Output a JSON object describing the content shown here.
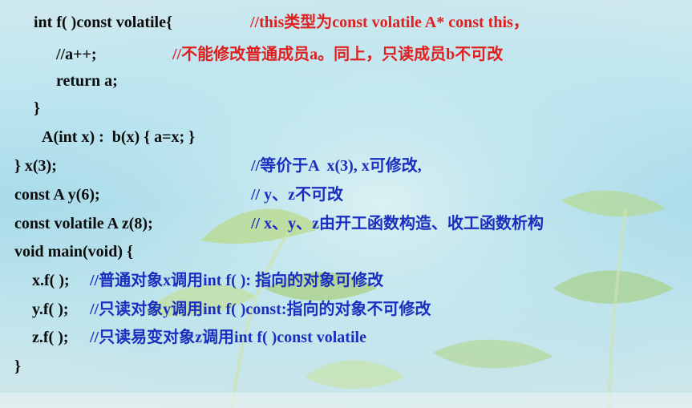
{
  "code_lines": [
    {
      "code": "int f( )const volatile{",
      "comment": "//this类型为const volatile A* const this，"
    },
    {
      "code": "//a++;",
      "comment": "//不能修改普通成员a。同上，只读成员b不可改"
    },
    {
      "code": "return a;"
    },
    {
      "code": "}"
    },
    {
      "code": "A(int x) :  b(x) { a=x; }"
    },
    {
      "code": "} x(3);",
      "comment": "//等价于A  x(3), x可修改,"
    },
    {
      "code": "const A y(6);",
      "comment": "// y、z不可改"
    },
    {
      "code": "const volatile A z(8);",
      "comment": "// x、y、z由开工函数构造、收工函数析构"
    },
    {
      "code": "void main(void) {"
    },
    {
      "code": "x.f( );",
      "comment": "//普通对象x调用int f( ): 指向的对象可修改"
    },
    {
      "code": "y.f( );",
      "comment": "//只读对象y调用int f( )const:指向的对象不可修改"
    },
    {
      "code": "z.f( );",
      "comment": "//只读易变对象z调用int f( )const volatile"
    },
    {
      "code": "}"
    }
  ]
}
